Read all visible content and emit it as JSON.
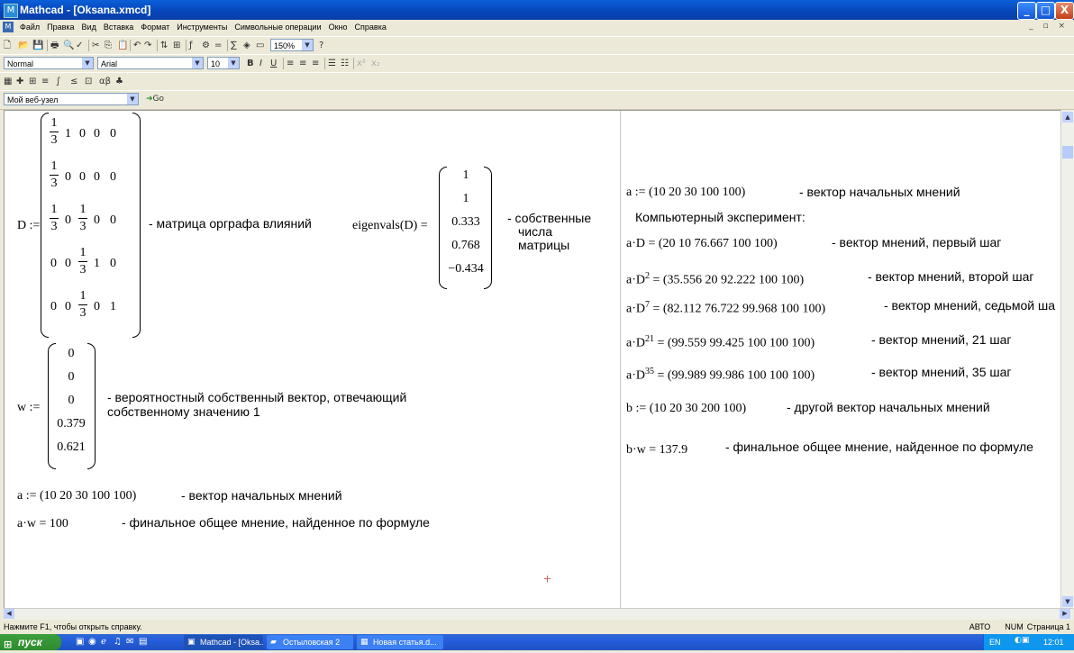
{
  "window": {
    "title": "Mathcad - [Oksana.xmcd]",
    "app_icon": "M",
    "min_label": "_",
    "max_label": "□",
    "close_label": "X",
    "colors": {
      "titlebar": "#0a5fd8",
      "close": "#c4401c"
    }
  },
  "menu": {
    "doc_icon": "M",
    "items": [
      "Файл",
      "Правка",
      "Вид",
      "Вставка",
      "Формат",
      "Инструменты",
      "Символьные операции",
      "Окно",
      "Справка"
    ],
    "mdi_controls": "_ ▫ ×"
  },
  "toolbar": {
    "standard_icons": [
      "new-icon",
      "open-icon",
      "save-icon",
      "print-icon",
      "preview-icon",
      "spell-icon",
      "cut-icon",
      "copy-icon",
      "paste-icon",
      "undo-icon",
      "redo-icon",
      "align-icon",
      "insert-icon",
      "function-icon",
      "units-icon",
      "equals-icon",
      "math-icon",
      "resource-icon",
      "region-icon"
    ],
    "zoom": "150%",
    "help_icon": "?",
    "style_value": "Normal",
    "font_value": "Arial",
    "font_size_value": "10",
    "bold": "B",
    "italic": "I",
    "underline": "U",
    "web_address_value": "Мой веб-узел",
    "go_label": "Go"
  },
  "worksheet": {
    "left": {
      "D_assign": "D :=",
      "D_matrix": [
        [
          "1/3",
          "1",
          "0",
          "0",
          "0"
        ],
        [
          "1/3",
          "0",
          "0",
          "0",
          "0"
        ],
        [
          "1/3",
          "0",
          "1/3",
          "0",
          "0"
        ],
        [
          "0",
          "0",
          "1/3",
          "1",
          "0"
        ],
        [
          "0",
          "0",
          "1/3",
          "0",
          "1"
        ]
      ],
      "D_comment": "- матрица орграфа влияний",
      "eig_expr": "eigenvals(D) =",
      "eig_values": [
        "1",
        "1",
        "0.333",
        "0.768",
        "−0.434"
      ],
      "eig_comment": [
        "- собственные",
        "числа",
        "матрицы"
      ],
      "w_assign": "w :=",
      "w_values": [
        "0",
        "0",
        "0",
        "0.379",
        "0.621"
      ],
      "w_comment": [
        "- вероятностный собственный вектор, отвечающий",
        "собственному значению 1"
      ],
      "a_assign": "a := (10  20  30  100  100)",
      "a_comment": "- вектор начальных мнений",
      "aw_expr": "a·w = 100",
      "aw_comment": "- финальное общее мнение, найденное по формуле",
      "crosshair": "+"
    },
    "right": {
      "a_assign": "a := (10  20  30  100  100)",
      "a_comment": "- вектор начальных мнений",
      "experiment": "Компьютерный эксперимент:",
      "steps": [
        {
          "base": "a·D",
          "power": "",
          "value": " = (20  10  76.667  100  100)",
          "comment": "- вектор мнений, первый шаг"
        },
        {
          "base": "a·D",
          "power": "2",
          "value": " = (35.556  20  92.222  100  100)",
          "comment": "- вектор мнений, второй шаг"
        },
        {
          "base": "a·D",
          "power": "7",
          "value": " = (82.112  76.722  99.968  100  100)",
          "comment": "- вектор мнений, седьмой ша"
        },
        {
          "base": "a·D",
          "power": "21",
          "value": " = (99.559  99.425  100  100  100)",
          "comment": "- вектор мнений, 21 шаг"
        },
        {
          "base": "a·D",
          "power": "35",
          "value": " = (99.989  99.986  100  100  100)",
          "comment": "- вектор мнений, 35 шаг"
        }
      ],
      "b_assign": "b := (10  20  30  200  100)",
      "b_comment": "- другой вектор начальных мнений",
      "bw_expr": "b·w = 137.9",
      "bw_comment": "- финальное общее мнение, найденное по формуле"
    }
  },
  "status": {
    "help": "Нажмите F1, чтобы открыть справку.",
    "mode": "АВТО",
    "num": "NUM",
    "page": "Страница 1"
  },
  "taskbar": {
    "start": "пуск",
    "tasks": [
      "Mathcad - [Oksa...",
      "Остыловская 2",
      "Новая статья.d..."
    ],
    "lang": "EN",
    "clock": "12:01"
  }
}
